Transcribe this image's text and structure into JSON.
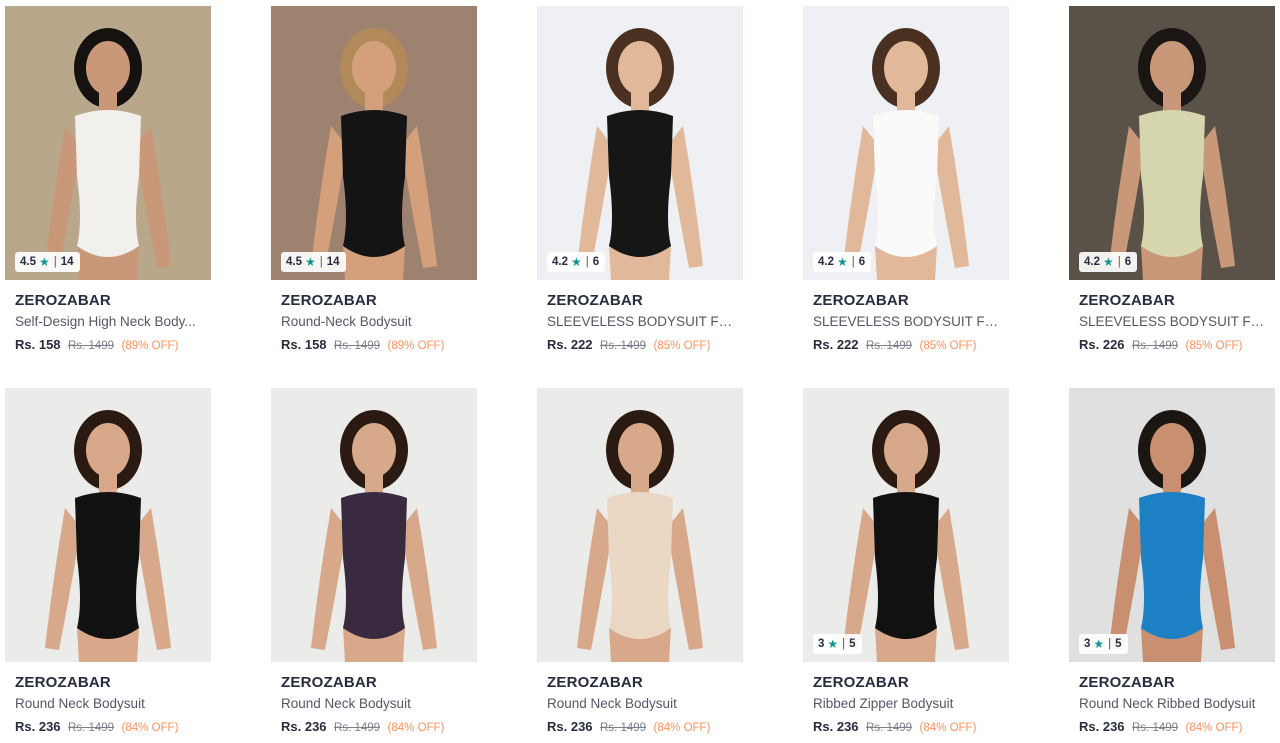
{
  "products": [
    {
      "brand": "ZEROZABAR",
      "name": "Self-Design High Neck Body...",
      "price": "Rs. 158",
      "mrp": "Rs. 1499",
      "off": "(89% OFF)",
      "rating": "4.5",
      "count": "14",
      "bg": "#b8a78a",
      "garment": "#f2f0ec",
      "skin": "#c89878",
      "hair": "#161210"
    },
    {
      "brand": "ZEROZABAR",
      "name": "Round-Neck Bodysuit",
      "price": "Rs. 158",
      "mrp": "Rs. 1499",
      "off": "(89% OFF)",
      "rating": "4.5",
      "count": "14",
      "bg": "#9e8270",
      "garment": "#141414",
      "skin": "#d4a07c",
      "hair": "#b28a5a"
    },
    {
      "brand": "ZEROZABAR",
      "name": "SLEEVELESS BODYSUIT FO...",
      "price": "Rs. 222",
      "mrp": "Rs. 1499",
      "off": "(85% OFF)",
      "rating": "4.2",
      "count": "6",
      "bg": "#eef0f3",
      "garment": "#161616",
      "skin": "#e2b89a",
      "hair": "#4a3020"
    },
    {
      "brand": "ZEROZABAR",
      "name": "SLEEVELESS BODYSUIT FO...",
      "price": "Rs. 222",
      "mrp": "Rs. 1499",
      "off": "(85% OFF)",
      "rating": "4.2",
      "count": "6",
      "bg": "#eef0f3",
      "garment": "#fafafa",
      "skin": "#e2b89a",
      "hair": "#4a3020"
    },
    {
      "brand": "ZEROZABAR",
      "name": "SLEEVELESS BODYSUIT FO...",
      "price": "Rs. 226",
      "mrp": "Rs. 1499",
      "off": "(85% OFF)",
      "rating": "4.2",
      "count": "6",
      "bg": "#5a5248",
      "garment": "#d6d6ae",
      "skin": "#c89878",
      "hair": "#1a1614"
    },
    {
      "brand": "ZEROZABAR",
      "name": "Round Neck Bodysuit",
      "price": "Rs. 236",
      "mrp": "Rs. 1499",
      "off": "(84% OFF)",
      "rating": "",
      "count": "",
      "bg": "#ebebea",
      "garment": "#121212",
      "skin": "#d7a889",
      "hair": "#2a1a12"
    },
    {
      "brand": "ZEROZABAR",
      "name": "Round Neck Bodysuit",
      "price": "Rs. 236",
      "mrp": "Rs. 1499",
      "off": "(84% OFF)",
      "rating": "",
      "count": "",
      "bg": "#ebebea",
      "garment": "#3a2a40",
      "skin": "#d7a889",
      "hair": "#2a1a12"
    },
    {
      "brand": "ZEROZABAR",
      "name": "Round Neck Bodysuit",
      "price": "Rs. 236",
      "mrp": "Rs. 1499",
      "off": "(84% OFF)",
      "rating": "",
      "count": "",
      "bg": "#ebebea",
      "garment": "#ead8c4",
      "skin": "#d7a889",
      "hair": "#2a1a12"
    },
    {
      "brand": "ZEROZABAR",
      "name": "Ribbed Zipper Bodysuit",
      "price": "Rs. 236",
      "mrp": "Rs. 1499",
      "off": "(84% OFF)",
      "rating": "3",
      "count": "5",
      "bg": "#ebebea",
      "garment": "#111111",
      "skin": "#d7a889",
      "hair": "#2a1a12"
    },
    {
      "brand": "ZEROZABAR",
      "name": "Round Neck Ribbed Bodysuit",
      "price": "Rs. 236",
      "mrp": "Rs. 1499",
      "off": "(84% OFF)",
      "rating": "3",
      "count": "5",
      "bg": "#e0e0e0",
      "garment": "#1d7fc4",
      "skin": "#c89070",
      "hair": "#1c1612"
    }
  ],
  "icons": {
    "star": "star-icon"
  },
  "colors": {
    "star": "#14958f",
    "discount": "#ff905a",
    "brand": "#282c3f"
  }
}
